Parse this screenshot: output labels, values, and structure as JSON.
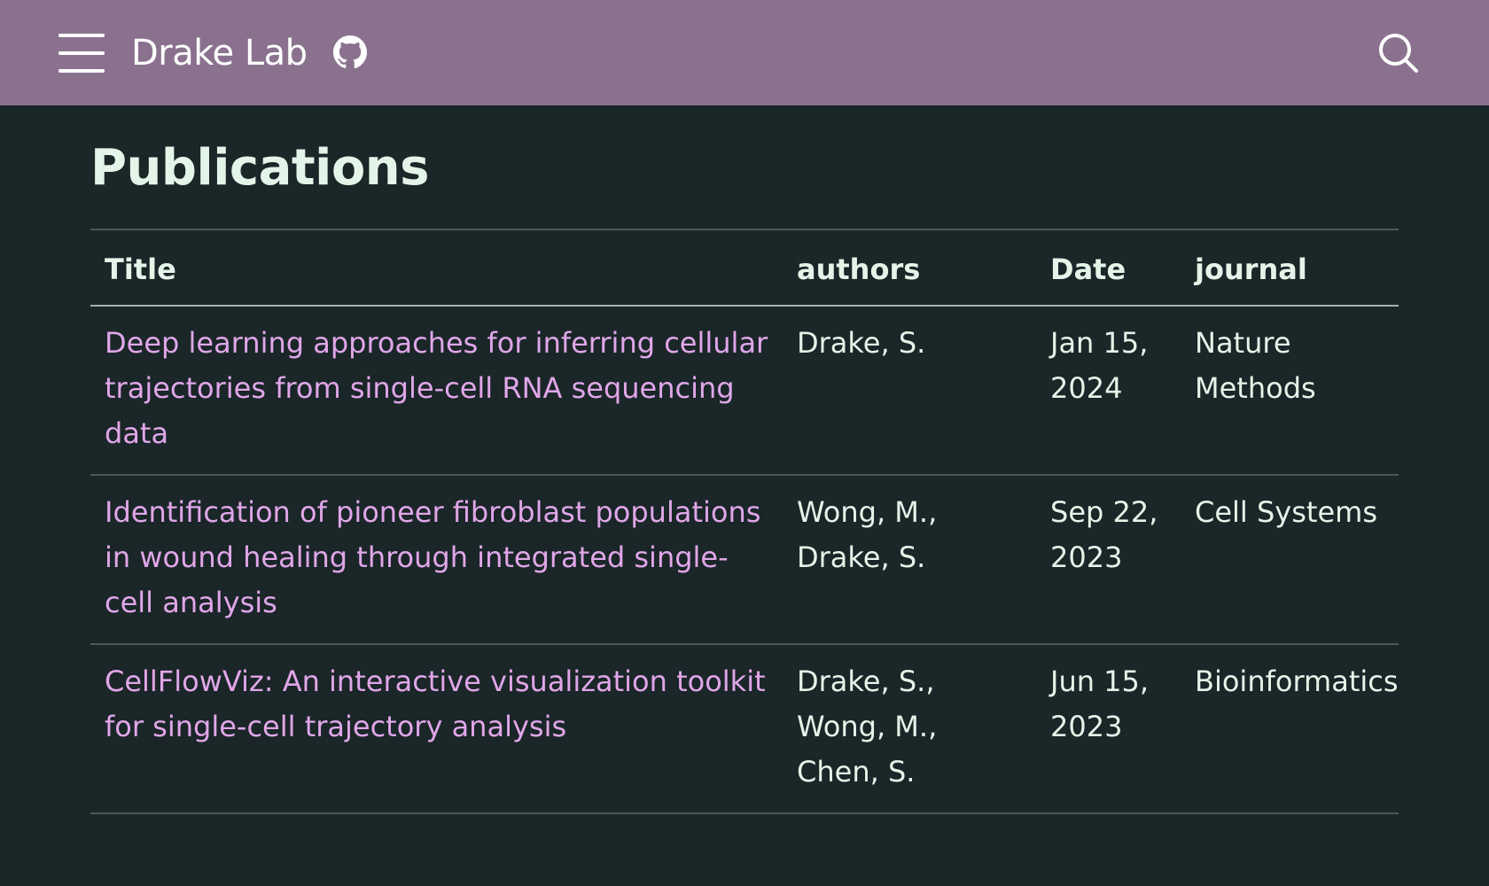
{
  "navbar": {
    "brand": "Drake Lab",
    "menu_icon": "hamburger-menu-icon",
    "github_icon": "github-icon",
    "search_icon": "search-icon",
    "background_color": "#8a728f"
  },
  "page": {
    "title": "Publications",
    "background_color": "#1a2628",
    "link_color": "#e0a6e8",
    "text_color": "#e3f4e8"
  },
  "table": {
    "headers": {
      "title": "Title",
      "authors": "authors",
      "date": "Date",
      "journal": "journal"
    },
    "rows": [
      {
        "title": "Deep learning approaches for inferring cellular trajectories from single-cell RNA sequencing data",
        "authors": "Drake, S.",
        "date": "Jan 15, 2024",
        "journal": "Nature Methods"
      },
      {
        "title": "Identification of pioneer fibroblast populations in wound healing through integrated single-cell analysis",
        "authors": "Wong, M., Drake, S.",
        "date": "Sep 22, 2023",
        "journal": "Cell Systems"
      },
      {
        "title": "CellFlowViz: An interactive visualization toolkit for single-cell trajectory analysis",
        "authors": "Drake, S., Wong, M., Chen, S.",
        "date": "Jun 15, 2023",
        "journal": "Bioinformatics"
      }
    ]
  }
}
